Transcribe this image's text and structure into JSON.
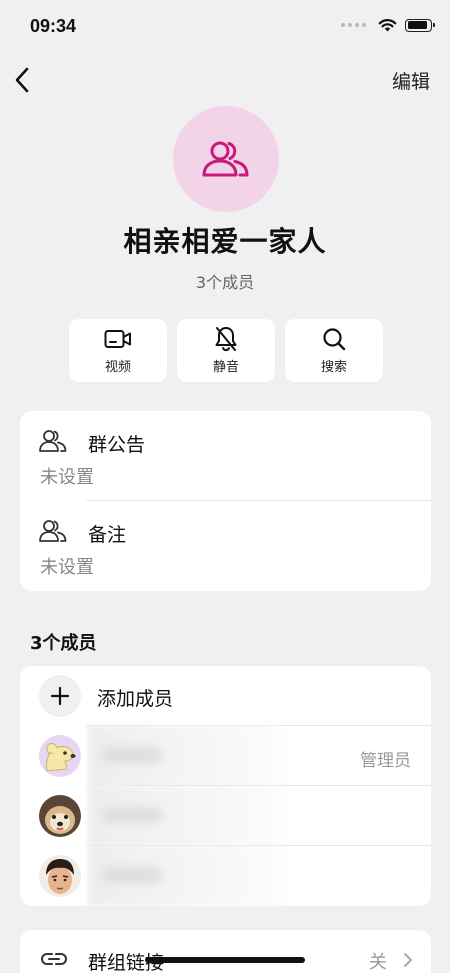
{
  "status_bar": {
    "time": "09:34",
    "battery_level": 0.9
  },
  "nav": {
    "edit_label": "编辑"
  },
  "group": {
    "name": "相亲相爱一家人",
    "member_count_label": "3个成员",
    "avatar_color": "#f3d3e8",
    "avatar_icon_color": "#c8197d"
  },
  "actions": [
    {
      "label": "视频",
      "icon": "video-icon"
    },
    {
      "label": "静音",
      "icon": "bell-off-icon"
    },
    {
      "label": "搜索",
      "icon": "search-icon"
    }
  ],
  "info": {
    "announcement": {
      "title": "群公告",
      "value": "未设置"
    },
    "remark": {
      "title": "备注",
      "value": "未设置"
    }
  },
  "members_section": {
    "title": "3个成员",
    "add_label": "添加成员",
    "members": [
      {
        "avatar": "cartoon-dog-avatar",
        "role": "管理员"
      },
      {
        "avatar": "dog-photo-avatar",
        "role": ""
      },
      {
        "avatar": "cartoon-boy-avatar",
        "role": ""
      }
    ]
  },
  "group_link": {
    "title": "群组链接",
    "value": "关"
  }
}
